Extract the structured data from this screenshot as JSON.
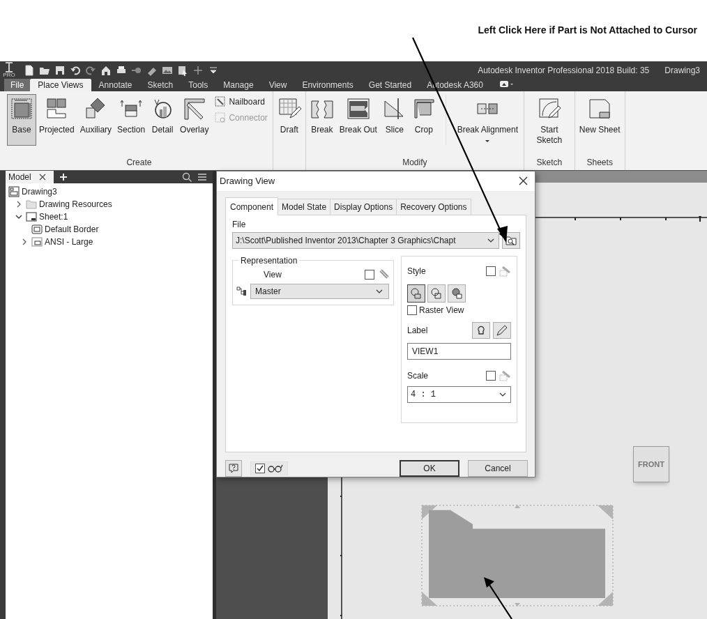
{
  "annotation": {
    "text": "Left Click Here if Part is Not Attached to Cursor"
  },
  "window": {
    "logo_text": "PRO",
    "title": "Autodesk Inventor Professional 2018 Build: 35",
    "document": "Drawing3"
  },
  "ribbon_tabs": [
    {
      "label": "File",
      "kind": "file",
      "selected": false
    },
    {
      "label": "Place Views",
      "kind": "tab",
      "selected": true
    },
    {
      "label": "Annotate",
      "kind": "tab",
      "selected": false
    },
    {
      "label": "Sketch",
      "kind": "tab",
      "selected": false
    },
    {
      "label": "Tools",
      "kind": "tab",
      "selected": false
    },
    {
      "label": "Manage",
      "kind": "tab",
      "selected": false
    },
    {
      "label": "View",
      "kind": "tab",
      "selected": false
    },
    {
      "label": "Environments",
      "kind": "tab",
      "selected": false
    },
    {
      "label": "Get Started",
      "kind": "tab",
      "selected": false
    },
    {
      "label": "Autodesk A360",
      "kind": "tab",
      "selected": false
    }
  ],
  "ribbon_groups": [
    {
      "label": "Create",
      "buttons": [
        {
          "label": "Base",
          "kind": "large",
          "selected": true,
          "disabled": false
        },
        {
          "label": "Projected",
          "kind": "large",
          "selected": false,
          "disabled": false
        },
        {
          "label": "Auxiliary",
          "kind": "large",
          "selected": false,
          "disabled": false
        },
        {
          "label": "Section",
          "kind": "large",
          "selected": false,
          "disabled": false
        },
        {
          "label": "Detail",
          "kind": "large",
          "selected": false,
          "disabled": false
        },
        {
          "label": "Overlay",
          "kind": "large",
          "selected": false,
          "disabled": false
        },
        {
          "label": "Nailboard",
          "kind": "small",
          "selected": false,
          "disabled": false
        },
        {
          "label": "Connector",
          "kind": "small",
          "selected": false,
          "disabled": true
        }
      ]
    },
    {
      "buttons": [
        {
          "label": "Draft",
          "kind": "large",
          "selected": false,
          "disabled": false
        }
      ]
    },
    {
      "label": "Modify",
      "buttons": [
        {
          "label": "Break",
          "kind": "large",
          "selected": false,
          "disabled": false
        },
        {
          "label": "Break Out",
          "kind": "large",
          "selected": false,
          "disabled": false
        },
        {
          "label": "Slice",
          "kind": "large",
          "selected": false,
          "disabled": false
        },
        {
          "label": "Crop",
          "kind": "large",
          "selected": false,
          "disabled": false
        },
        {
          "label": "Break Alignment",
          "kind": "menu",
          "selected": false,
          "disabled": false
        }
      ]
    },
    {
      "label": "Sketch",
      "buttons": [
        {
          "label": "Start Sketch",
          "kind": "large",
          "selected": false,
          "disabled": false
        }
      ]
    },
    {
      "label": "Sheets",
      "buttons": [
        {
          "label": "New Sheet",
          "kind": "large",
          "selected": false,
          "disabled": false
        }
      ]
    }
  ],
  "browser": {
    "tabs": [
      {
        "label": "Model",
        "selected": true
      }
    ],
    "tree": [
      {
        "label": "Drawing3",
        "kind": "drawing",
        "children": [
          {
            "label": "Drawing Resources",
            "kind": "folder",
            "expanded": false
          },
          {
            "label": "Sheet:1",
            "kind": "sheet",
            "expanded": true,
            "children": [
              {
                "label": "Default Border",
                "kind": "border"
              },
              {
                "label": "ANSI - Large",
                "kind": "titleblock",
                "expanded": false
              }
            ]
          }
        ]
      }
    ]
  },
  "dialog": {
    "title": "Drawing View",
    "tabs": [
      {
        "label": "Component",
        "selected": true
      },
      {
        "label": "Model State",
        "selected": false
      },
      {
        "label": "Display Options",
        "selected": false
      },
      {
        "label": "Recovery Options",
        "selected": false
      }
    ],
    "file": {
      "label": "File",
      "value": "J:\\Scott\\Published Inventor 2013\\Chapter 3 Graphics\\Chapt"
    },
    "representation": {
      "legend": "Representation",
      "view_label": "View",
      "view_checked": false,
      "view_value": "Master"
    },
    "style": {
      "label": "Style",
      "checked": false,
      "buttons": [
        {
          "selected": true
        },
        {
          "selected": false
        },
        {
          "selected": false
        }
      ],
      "raster_label": "Raster View",
      "raster_checked": false
    },
    "label": {
      "label": "Label",
      "value": "VIEW1"
    },
    "scale": {
      "label": "Scale",
      "checked": false,
      "value": "4 : 1"
    },
    "preview_checked": true,
    "buttons": [
      {
        "label": "OK",
        "kind": "default"
      },
      {
        "label": "Cancel",
        "kind": "normal"
      }
    ]
  },
  "canvas": {
    "view_cube_label": "FRONT"
  }
}
